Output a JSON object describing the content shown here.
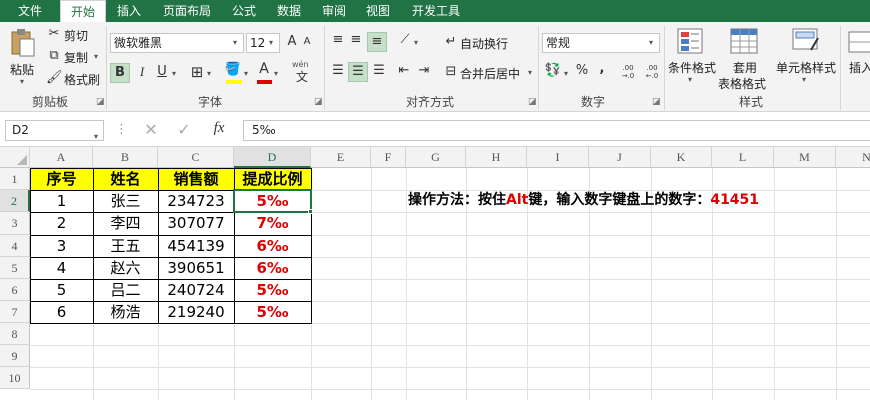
{
  "ribbon_tabs": [
    "文件",
    "开始",
    "插入",
    "页面布局",
    "公式",
    "数据",
    "审阅",
    "视图",
    "开发工具"
  ],
  "active_tab": "开始",
  "clipboard": {
    "paste": "粘贴",
    "cut": "剪切",
    "copy": "复制",
    "format_painter": "格式刷",
    "group": "剪贴板"
  },
  "font": {
    "name": "微软雅黑",
    "size": "12",
    "bold": "B",
    "italic": "I",
    "underline": "U",
    "group": "字体",
    "grow": "A",
    "shrink": "A",
    "font_color": "A",
    "wen": "wén"
  },
  "alignment": {
    "wrap_text": "自动换行",
    "merge_center": "合并后居中",
    "group": "对齐方式"
  },
  "number": {
    "format": "常规",
    "percent": "%",
    "comma": ",",
    "group": "数字",
    "inc_decimal": ".00 →.0",
    "dec_decimal": ".00 ←.0"
  },
  "styles": {
    "conditional": "条件格式",
    "table_format": "套用\n表格格式",
    "table_format_line1": "套用",
    "table_format_line2": "表格格式",
    "cell_styles": "单元格样式",
    "group": "样式"
  },
  "cells": {
    "insert": "插入"
  },
  "formula_bar": {
    "name_box": "D2",
    "fx": "fx",
    "content": "5‰"
  },
  "columns": [
    "A",
    "B",
    "C",
    "D",
    "E",
    "F",
    "G",
    "H",
    "I",
    "J",
    "K",
    "L",
    "M",
    "N"
  ],
  "rows": [
    "1",
    "2",
    "3",
    "4",
    "5",
    "6",
    "7",
    "8",
    "9",
    "10"
  ],
  "table": {
    "headers": [
      "序号",
      "姓名",
      "销售额",
      "提成比例"
    ],
    "rows": [
      [
        "1",
        "张三",
        "234723",
        "5‰"
      ],
      [
        "2",
        "李四",
        "307077",
        "7‰"
      ],
      [
        "3",
        "王五",
        "454139",
        "6‰"
      ],
      [
        "4",
        "赵六",
        "390651",
        "6‰"
      ],
      [
        "5",
        "吕二",
        "240724",
        "5‰"
      ],
      [
        "6",
        "杨浩",
        "219240",
        "5‰"
      ]
    ]
  },
  "note": {
    "prefix": "操作方法：按住",
    "key": "Alt",
    "middle": "键，输入数字键盘上的数字：",
    "code": "41451"
  },
  "colors": {
    "accent": "#217346",
    "header_fill": "#ffff00",
    "percent_text": "#e00000"
  }
}
